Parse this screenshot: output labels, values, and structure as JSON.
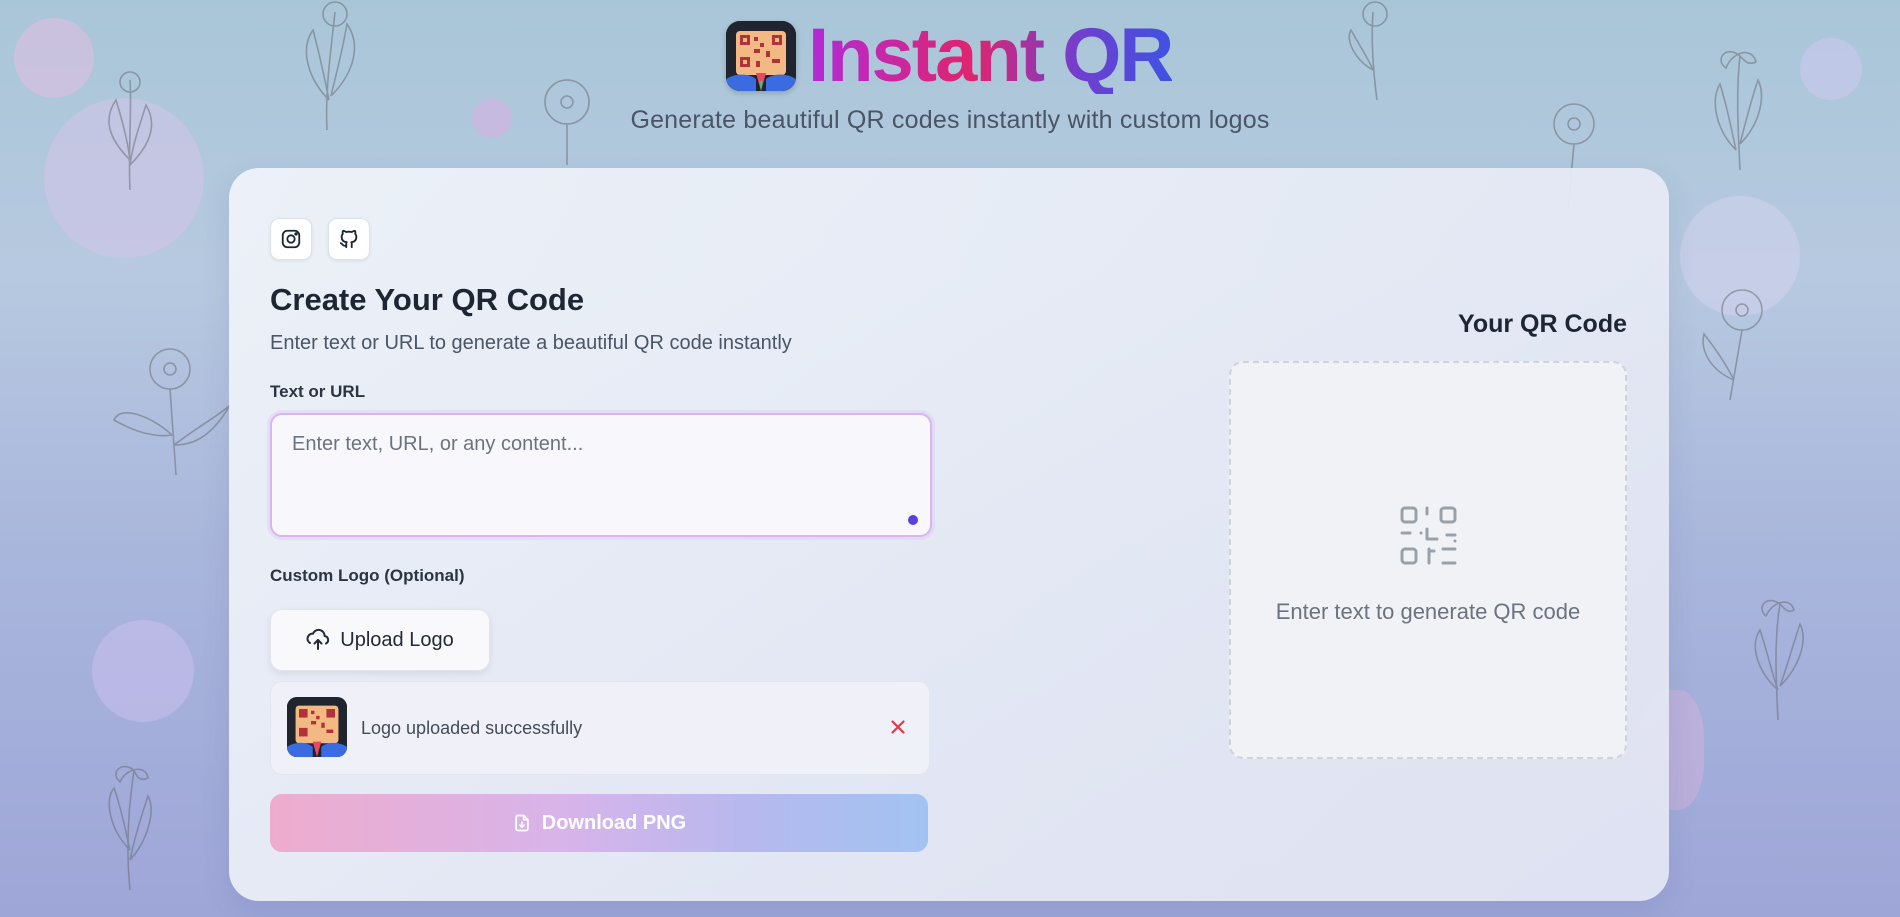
{
  "app": {
    "title": "Instant QR",
    "subtitle": "Generate beautiful QR codes instantly with custom logos",
    "brand_logo_icon": "qr-avatar-icon"
  },
  "social": [
    {
      "icon": "instagram-icon"
    },
    {
      "icon": "github-icon"
    }
  ],
  "form": {
    "heading": "Create Your QR Code",
    "description": "Enter text or URL to generate a beautiful QR code instantly",
    "text_label": "Text or URL",
    "text_placeholder": "Enter text, URL, or any content...",
    "text_value": "",
    "logo_label": "Custom Logo (Optional)",
    "upload_button": "Upload Logo",
    "upload_icon": "cloud-upload-icon",
    "uploaded_message": "Logo uploaded successfully",
    "remove_icon": "close-icon",
    "download_button": "Download PNG",
    "download_icon": "file-download-icon",
    "download_enabled": false
  },
  "preview": {
    "heading": "Your QR Code",
    "placeholder_text": "Enter text to generate QR code",
    "placeholder_icon": "qr-code-icon"
  },
  "colors": {
    "title_gradient": [
      "#b02bd8",
      "#e0246e",
      "#6f3fd0",
      "#3f52e2"
    ],
    "accent_border": "#d8b4f2",
    "remove": "#e53945",
    "download_gradient": [
      "#eeaccd",
      "#d7b4ea",
      "#b4b9ee",
      "#a2c3f2"
    ]
  }
}
